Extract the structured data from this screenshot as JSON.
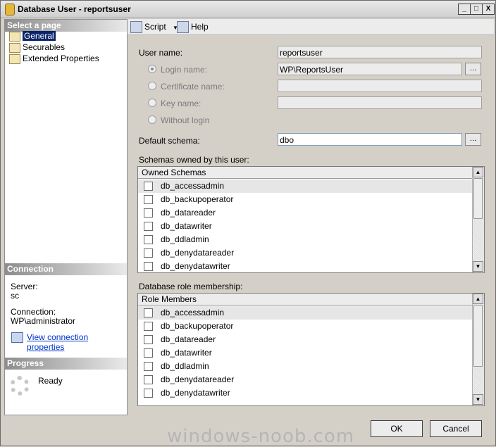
{
  "window": {
    "title": "Database User - reportsuser",
    "controls": [
      "_",
      "□",
      "X"
    ]
  },
  "left": {
    "select_page_header": "Select a page",
    "pages": [
      {
        "label": "General",
        "icon": "page-icon",
        "selected": true
      },
      {
        "label": "Securables",
        "icon": "page-icon",
        "selected": false
      },
      {
        "label": "Extended Properties",
        "icon": "page-icon",
        "selected": false
      }
    ],
    "connection_header": "Connection",
    "server_label": "Server:",
    "server_value": "sc",
    "connection_label": "Connection:",
    "connection_value": "WP\\administrator",
    "view_link": "View connection properties",
    "progress_header": "Progress",
    "progress_status": "Ready"
  },
  "toolbar": {
    "script_label": "Script",
    "help_label": "Help"
  },
  "form": {
    "user_name_label": "User name:",
    "user_name_value": "reportsuser",
    "login_name_label": "Login name:",
    "login_name_value": "WP\\ReportsUser",
    "certificate_name_label": "Certificate name:",
    "key_name_label": "Key name:",
    "without_login_label": "Without login",
    "default_schema_label": "Default schema:",
    "default_schema_value": "dbo",
    "browse_label": "...",
    "schemas_owned_label": "Schemas owned by this user:",
    "schemas_header": "Owned Schemas",
    "schemas": [
      "db_accessadmin",
      "db_backupoperator",
      "db_datareader",
      "db_datawriter",
      "db_ddladmin",
      "db_denydatareader",
      "db_denydatawriter"
    ],
    "role_membership_label": "Database role membership:",
    "roles_header": "Role Members",
    "roles": [
      "db_accessadmin",
      "db_backupoperator",
      "db_datareader",
      "db_datawriter",
      "db_ddladmin",
      "db_denydatareader",
      "db_denydatawriter"
    ]
  },
  "footer": {
    "ok_label": "OK",
    "cancel_label": "Cancel",
    "watermark": "windows-noob.com"
  }
}
